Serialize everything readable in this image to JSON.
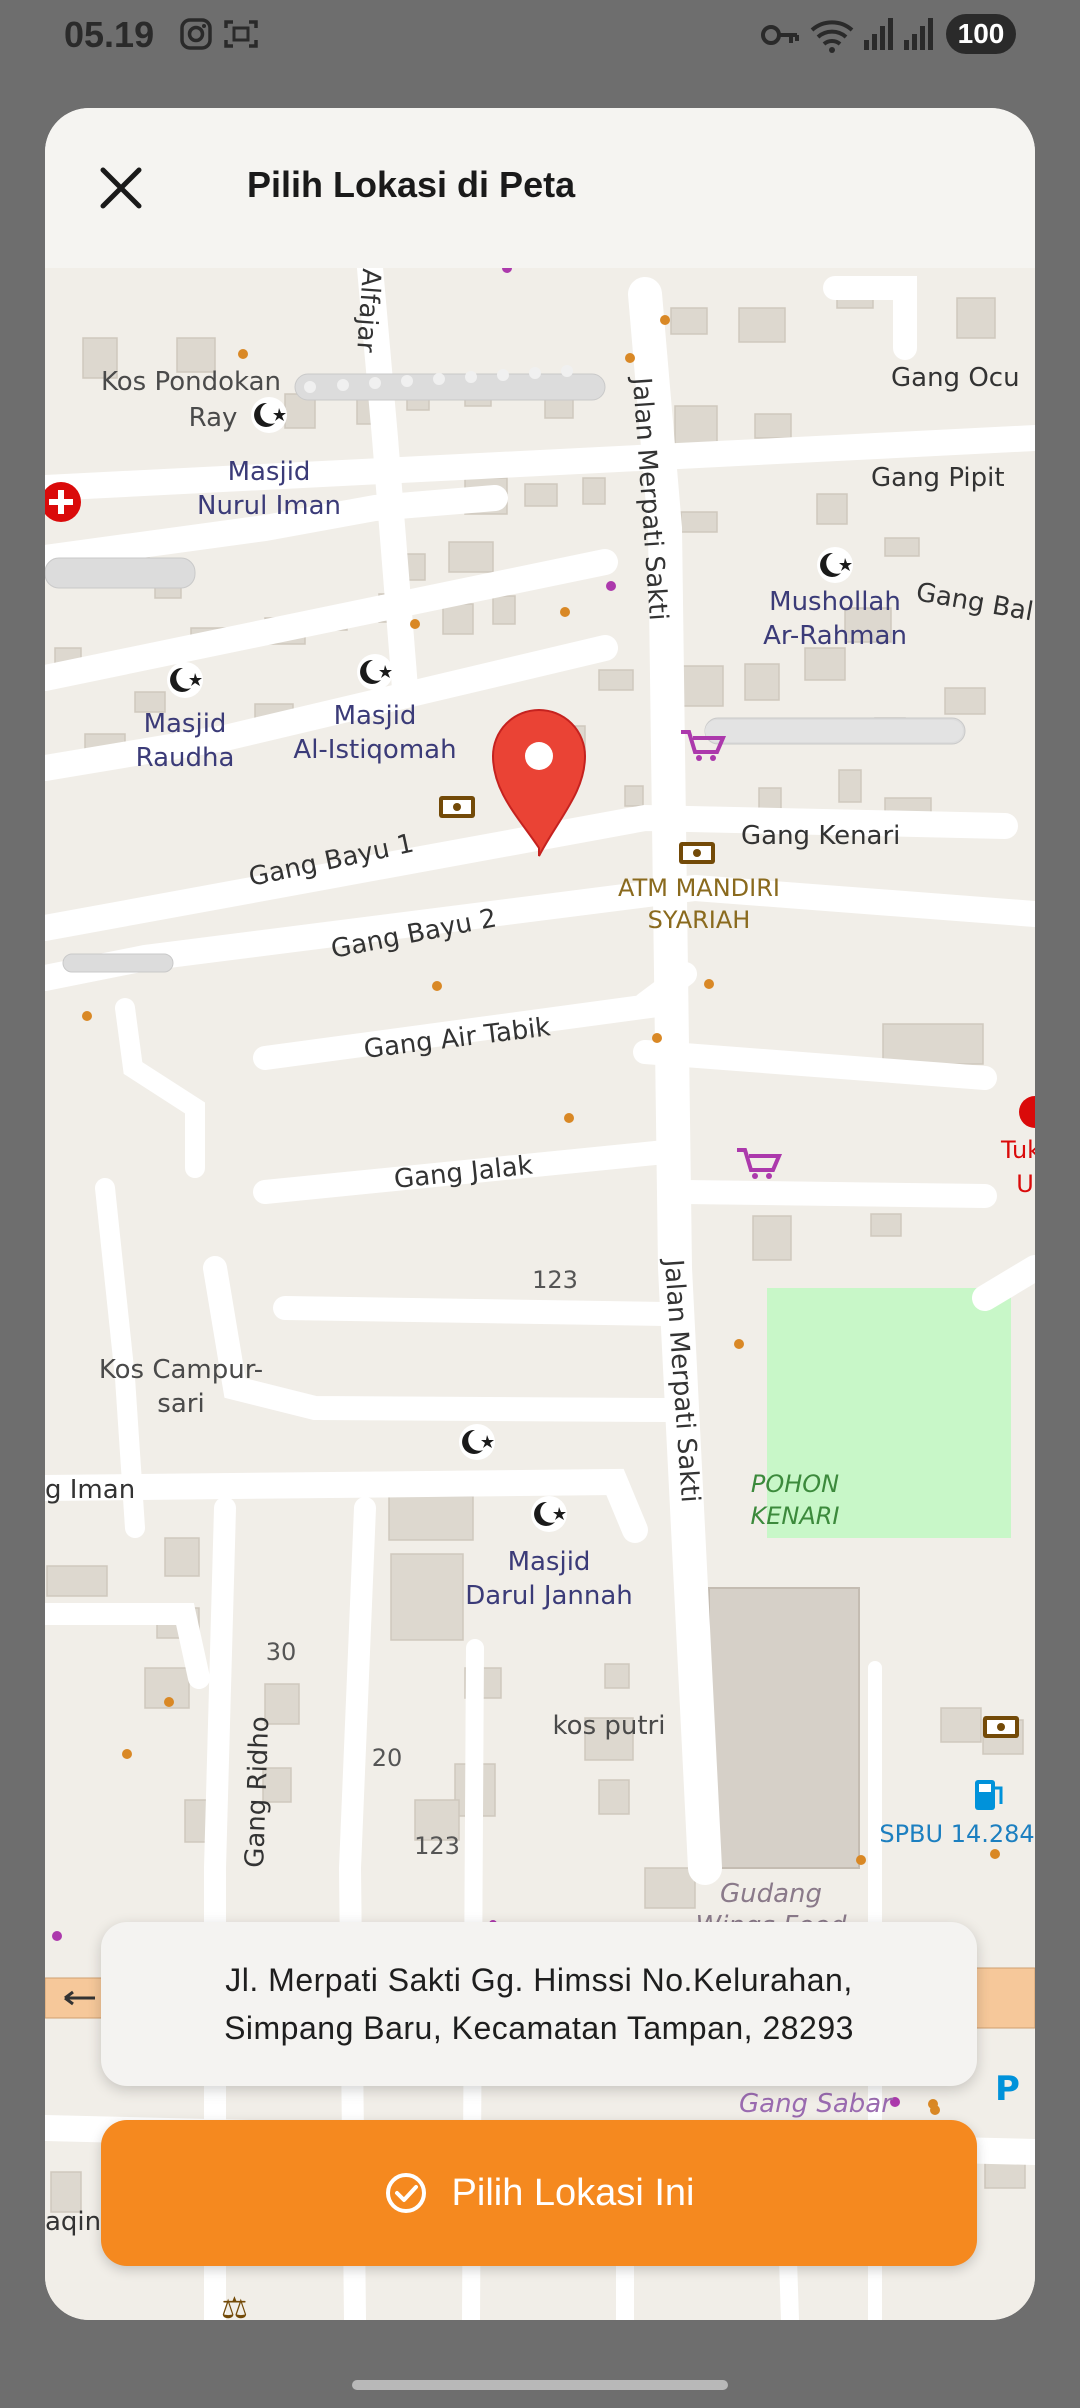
{
  "status_bar": {
    "time": "05.19",
    "battery": "100"
  },
  "header": {
    "title": "Pilih Lokasi di Peta"
  },
  "map": {
    "streets": {
      "gang_bayu_1": "Gang Bayu 1",
      "gang_bayu_2": "Gang Bayu 2",
      "gang_air_tabik": "Gang Air Tabik",
      "gang_jalak": "Gang Jalak",
      "gang_kenari": "Gang Kenari",
      "jalan_merpati_sakti": "Jalan Merpati Sakti",
      "jalan_alfajar": "Alfajar",
      "gang_ocu": "Gang Ocu",
      "gang_pipit": "Gang Pipit",
      "gang_bal": "Gang Bal",
      "gang_iman": "g Iman",
      "gang_ridho": "Gang Ridho",
      "gang_sabar": "Gang Sabar",
      "aqin": "aqin"
    },
    "pois": {
      "kos_pondokan_1": "Kos Pondokan",
      "kos_pondokan_2": "Ray",
      "masjid_nurul_iman_1": "Masjid",
      "masjid_nurul_iman_2": "Nurul Iman",
      "mushollah_1": "Mushollah",
      "mushollah_2": "Ar-Rahman",
      "masjid_raudha_1": "Masjid",
      "masjid_raudha_2": "Raudha",
      "masjid_istiqomah_1": "Masjid",
      "masjid_istiqomah_2": "Al-Istiqomah",
      "atm_mandiri_1": "ATM MANDIRI",
      "atm_mandiri_2": "SYARIAH",
      "kos_campur_1": "Kos Campur-",
      "kos_campur_2": "sari",
      "pohon_kenari_1": "POHON",
      "pohon_kenari_2": "KENARI",
      "masjid_darul_1": "Masjid",
      "masjid_darul_2": "Darul Jannah",
      "kos_putri": "kos putri",
      "spbu": "SPBU 14.284",
      "gudang_1": "Gudang",
      "gudang_2": "Wings Food",
      "tuk_1": "Tuk",
      "tuk_2": "U",
      "num_123_a": "123",
      "num_123_b": "123",
      "num_30": "30",
      "num_20": "20"
    }
  },
  "address": {
    "text": "Jl. Merpati Sakti Gg. Himssi No.Kelurahan, Simpang Baru, Kecamatan Tampan, 28293"
  },
  "confirm_button": {
    "label": "Pilih Lokasi Ini"
  },
  "colors": {
    "accent": "#f5891f",
    "pin": "#ea4335",
    "mosque": "#1a1a1a",
    "park": "#c8f7c8"
  }
}
